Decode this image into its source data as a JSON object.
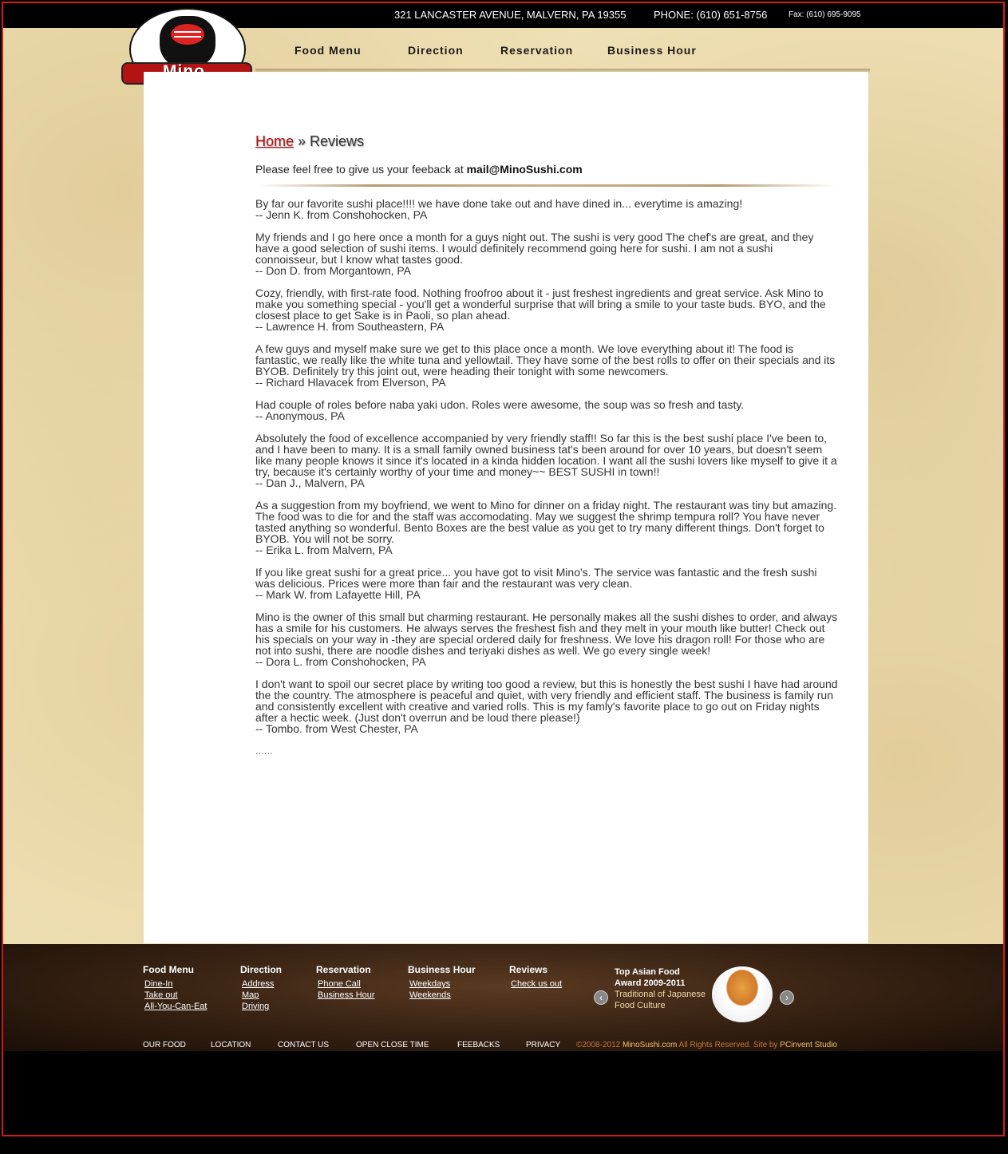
{
  "topbar": {
    "address": "321 LANCASTER AVENUE, MALVERN, PA 19355",
    "phone": "PHONE: (610) 651-8756",
    "fax": "Fax: (610) 695-9095"
  },
  "logo": {
    "name": "Mino",
    "reg": "®"
  },
  "nav": [
    {
      "label": "Food Menu"
    },
    {
      "label": "Direction"
    },
    {
      "label": "Reservation"
    },
    {
      "label": "Business Hour"
    }
  ],
  "breadcrumb": {
    "home": "Home",
    "separator": " » ",
    "current": "Reviews"
  },
  "intro": {
    "text": "Please feel free to give us your feeback at ",
    "email": "mail@MinoSushi.com"
  },
  "reviews": [
    {
      "text": "By far our favorite sushi place!!!! we have done take out and have dined in... everytime is amazing!",
      "author": "-- Jenn K. from Conshohocken, PA"
    },
    {
      "text": "My friends and I go here once a month for a guys night out. The sushi is very good The chef's are great, and they have a good selection of sushi items. I would definitely recommend going here for sushi. I am not a sushi connoisseur, but I know what tastes good.",
      "author": "-- Don D. from Morgantown, PA"
    },
    {
      "text": "Cozy, friendly, with first-rate food. Nothing froofroo about it - just freshest ingredients and great service. Ask Mino to make you something special - you'll get a wonderful surprise that will bring a smile to your taste buds. BYO, and the closest place to get Sake is in Paoli, so plan ahead.",
      "author": "-- Lawrence H. from Southeastern, PA"
    },
    {
      "text": "A few guys and myself make sure we get to this place once a month. We love everything about it! The food is fantastic, we really like the white tuna and yellowtail. They have some of the best rolls to offer on their specials and its BYOB. Definitely try this joint out, were heading their tonight with some newcomers.",
      "author": "-- Richard Hlavacek from Elverson, PA"
    },
    {
      "text": "Had couple of roles before naba yaki udon. Roles were awesome, the soup was so fresh and tasty.",
      "author": "-- Anonymous, PA"
    },
    {
      "text": "Absolutely the food of excellence accompanied by very friendly staff!! So far this is the best sushi place I've been to, and I have been to many. It is a small family owned business tat's been around for over 10 years, but doesn't seem like many people knows it since it's located in a kinda hidden location. I want all the sushi lovers like myself to give it a try, because it's certainly worthy of your time and money~~ BEST SUSHI in town!!",
      "author": "-- Dan J., Malvern, PA"
    },
    {
      "text": "As a suggestion from my boyfriend, we went to Mino for dinner on a friday night. The restaurant was tiny but amazing. The food was to die for and the staff was accomodating. May we suggest the shrimp tempura roll? You have never tasted anything so wonderful. Bento Boxes are the best value as you get to try many different things. Don't forget to BYOB. You will not be sorry.",
      "author": "-- Erika L. from Malvern, PA"
    },
    {
      "text": "If you like great sushi for a great price... you have got to visit Mino's. The service was fantastic and the fresh sushi was delicious. Prices were more than fair and the restaurant was very clean.",
      "author": "-- Mark W. from Lafayette Hill, PA"
    },
    {
      "text": "Mino is the owner of this small but charming restaurant. He personally makes all the sushi dishes to order, and always has a smile for his customers. He always serves the freshest fish and they melt in your mouth like butter! Check out his specials on your way in -they are special ordered daily for freshness. We love his dragon roll! For those who are not into sushi, there are noodle dishes and teriyaki dishes as well. We go every single week!",
      "author": "-- Dora L. from Conshohocken, PA"
    },
    {
      "text": "I don't want to spoil our secret place by writing too good a review, but this is honestly the best sushi I have had around the the country. The atmosphere is peaceful and quiet, with very friendly and efficient staff. The business is family run and consistently excellent with creative and varied rolls. This is my famly's favorite place to go out on Friday nights after a hectic week. (Just don't overrun and be loud there please!)",
      "author": "-- Tombo. from West Chester, PA"
    }
  ],
  "ellipsis": "......",
  "footer": {
    "columns": [
      {
        "title": "Food Menu",
        "links": [
          "Dine-In",
          "Take out",
          "All-You-Can-Eat"
        ]
      },
      {
        "title": "Direction",
        "links": [
          "Address",
          "Map",
          "Driving"
        ]
      },
      {
        "title": "Reservation",
        "links": [
          "Phone Call",
          "Business Hour"
        ]
      },
      {
        "title": "Business Hour",
        "links": [
          "Weekdays",
          "Weekends"
        ]
      },
      {
        "title": "Reviews",
        "links": [
          "Check us out"
        ]
      }
    ],
    "award": {
      "title1": "Top Asian Food",
      "title2": "Award 2009-2011",
      "sub1": "Traditional of Japanese",
      "sub2": "Food Culture"
    },
    "bottom_links": [
      "OUR FOOD",
      "LOCATION",
      "CONTACT US",
      "OPEN CLOSE TIME",
      "FEEBACKS",
      "PRIVACY"
    ],
    "copyright": {
      "year": "©2008-2012 ",
      "site": "MinoSushi.com",
      "rights": " All Rights Reserved. Site by ",
      "studio": "PCinvent Studio"
    }
  },
  "colors": {
    "accent": "#b40b0b",
    "border": "#d41b1b"
  }
}
